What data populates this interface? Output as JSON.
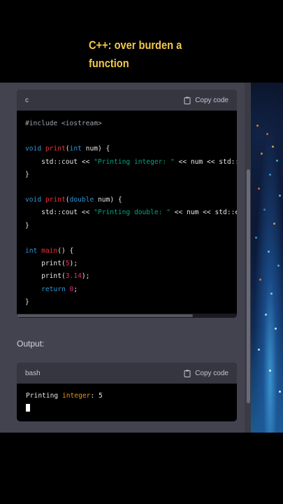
{
  "caption": {
    "line1": "C++: over burden a",
    "line2": "function"
  },
  "code_block": {
    "language": "c",
    "copy_label": "Copy code",
    "copy_icon": "clipboard-icon",
    "lines": [
      [
        {
          "t": "#include <iostream>",
          "c": "pp"
        }
      ],
      [],
      [
        {
          "t": "void ",
          "c": "kw"
        },
        {
          "t": "print",
          "c": "fn"
        },
        {
          "t": "(",
          "c": ""
        },
        {
          "t": "int",
          "c": "kw"
        },
        {
          "t": " num) {",
          "c": ""
        }
      ],
      [
        {
          "t": "    std::cout << ",
          "c": ""
        },
        {
          "t": "\"Printing integer: \"",
          "c": "st"
        },
        {
          "t": " << num << std::endl;",
          "c": ""
        }
      ],
      [
        {
          "t": "}",
          "c": ""
        }
      ],
      [],
      [
        {
          "t": "void ",
          "c": "kw"
        },
        {
          "t": "print",
          "c": "fn"
        },
        {
          "t": "(",
          "c": ""
        },
        {
          "t": "double",
          "c": "kw"
        },
        {
          "t": " num) {",
          "c": ""
        }
      ],
      [
        {
          "t": "    std::cout << ",
          "c": ""
        },
        {
          "t": "\"Printing double: \"",
          "c": "st"
        },
        {
          "t": " << num << std::endl;",
          "c": ""
        }
      ],
      [
        {
          "t": "}",
          "c": ""
        }
      ],
      [],
      [
        {
          "t": "int ",
          "c": "kw"
        },
        {
          "t": "main",
          "c": "fn"
        },
        {
          "t": "() {",
          "c": ""
        }
      ],
      [
        {
          "t": "    print(",
          "c": ""
        },
        {
          "t": "5",
          "c": "nu"
        },
        {
          "t": ");",
          "c": ""
        }
      ],
      [
        {
          "t": "    print(",
          "c": ""
        },
        {
          "t": "3.14",
          "c": "nu"
        },
        {
          "t": ");",
          "c": ""
        }
      ],
      [
        {
          "t": "    ",
          "c": ""
        },
        {
          "t": "return ",
          "c": "kw"
        },
        {
          "t": "0",
          "c": "nu"
        },
        {
          "t": ";",
          "c": ""
        }
      ],
      [
        {
          "t": "}",
          "c": ""
        }
      ]
    ]
  },
  "output": {
    "label": "Output:",
    "language": "bash",
    "copy_label": "Copy code",
    "copy_icon": "clipboard-icon",
    "lines": [
      [
        {
          "t": "Printing ",
          "c": ""
        },
        {
          "t": "integer",
          "c": "ty"
        },
        {
          "t": ": 5",
          "c": ""
        }
      ]
    ]
  }
}
